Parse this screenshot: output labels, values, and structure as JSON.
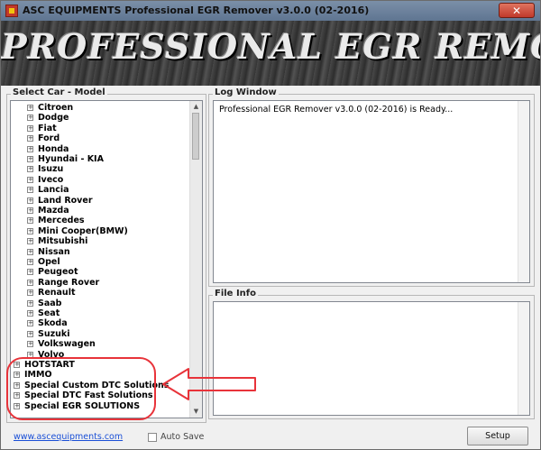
{
  "window": {
    "title": "ASC EQUIPMENTS Professional EGR Remover  v3.0.0 (02-2016)",
    "close_glyph": "✕"
  },
  "banner": {
    "text": "PROFESSIONAL EGR REMOVER"
  },
  "select_car": {
    "label": "Select Car - Model",
    "items": [
      "Citroen",
      "Dodge",
      "Fiat",
      "Ford",
      "Honda",
      "Hyundai - KIA",
      "Isuzu",
      "Iveco",
      "Lancia",
      "Land Rover",
      "Mazda",
      "Mercedes",
      "Mini Cooper(BMW)",
      "Mitsubishi",
      "Nissan",
      "Opel",
      "Peugeot",
      "Range Rover",
      "Renault",
      "Saab",
      "Seat",
      "Skoda",
      "Suzuki",
      "Volkswagen",
      "Volvo"
    ],
    "root_items": [
      "HOTSTART",
      "IMMO",
      "Special Custom DTC Solutions",
      "Special DTC Fast Solutions",
      "Special EGR SOLUTIONS"
    ],
    "expander_glyph": "+",
    "scroll_up_glyph": "▲",
    "scroll_down_glyph": "▼"
  },
  "log_window": {
    "label": "Log Window",
    "text": "Professional EGR Remover  v3.0.0 (02-2016) is Ready..."
  },
  "file_info": {
    "label": "File Info"
  },
  "footer": {
    "link": "www.ascequipments.com",
    "auto_save_label": "Auto Save",
    "setup_label": "Setup"
  },
  "colors": {
    "annotation": "#e8333a",
    "link": "#1a4fd6",
    "titlebar": "#6b7f9a"
  }
}
